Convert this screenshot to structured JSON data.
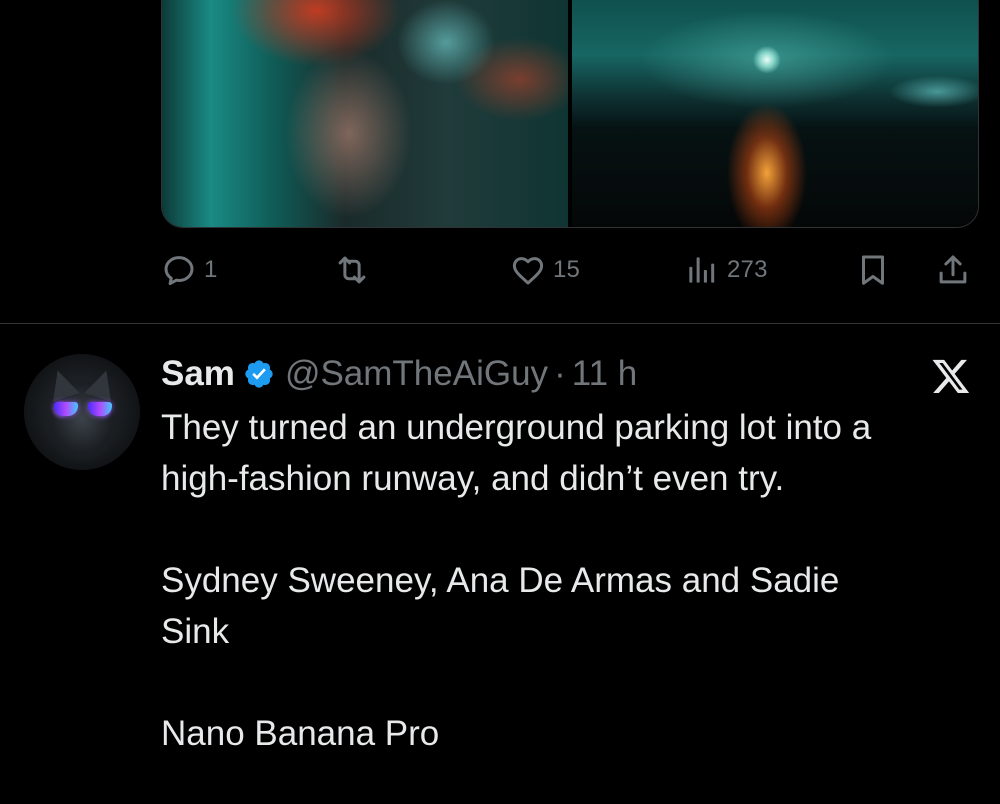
{
  "previous_tweet": {
    "media": [
      "photo-woman-motion-blur",
      "photo-moon-over-sea"
    ],
    "actions": {
      "reply_count": "1",
      "retweet_count": "",
      "like_count": "15",
      "view_count": "273"
    }
  },
  "tweet": {
    "author": {
      "name": "Sam",
      "handle": "@SamTheAiGuy",
      "separator": "·",
      "time": "11 h",
      "verified": true
    },
    "lines": [
      "They turned an underground parking lot into a",
      "high-fashion runway, and didn’t even try.",
      "",
      "Sydney Sweeney, Ana De Armas and Sadie",
      "Sink",
      "",
      "Nano Banana Pro"
    ]
  },
  "colors": {
    "background": "#000000",
    "text_primary": "#e7e9ea",
    "text_secondary": "#71767b",
    "divider": "#2f3336",
    "verified_badge": "#1d9bf0"
  },
  "icons": [
    "reply-icon",
    "retweet-icon",
    "like-icon",
    "views-icon",
    "bookmark-icon",
    "share-icon",
    "verified-badge-icon",
    "x-logo-icon"
  ]
}
